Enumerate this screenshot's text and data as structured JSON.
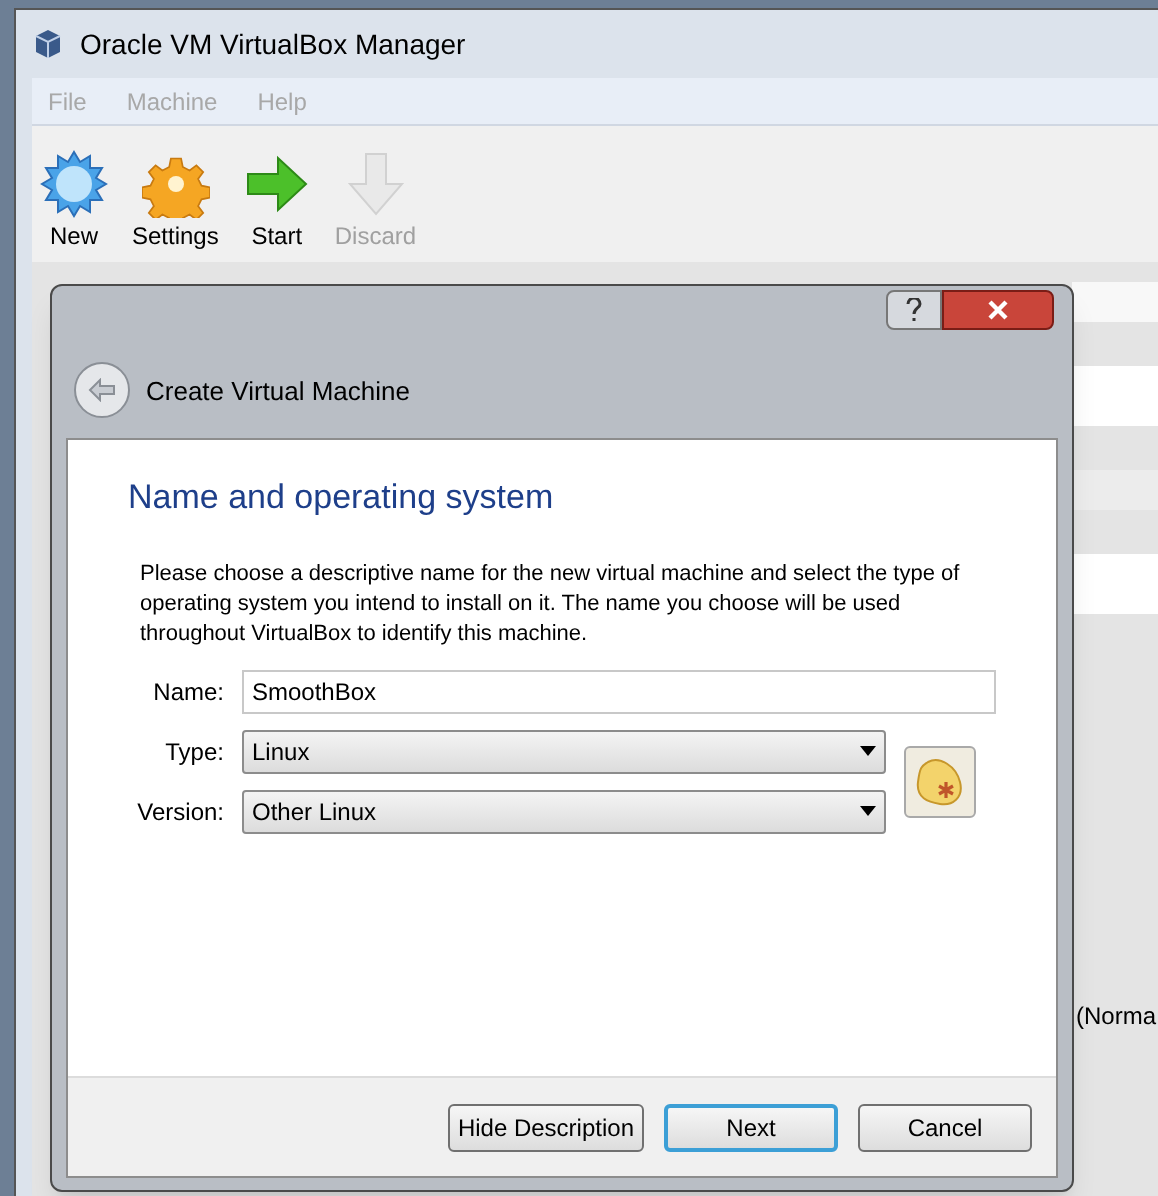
{
  "window": {
    "title": "Oracle VM VirtualBox Manager"
  },
  "menu": [
    {
      "label": "File",
      "disabled": true
    },
    {
      "label": "Machine",
      "disabled": true
    },
    {
      "label": "Help",
      "disabled": true
    }
  ],
  "toolbar": [
    {
      "kind": "new",
      "label": "New",
      "disabled": false
    },
    {
      "kind": "settings",
      "label": "Settings",
      "disabled": false
    },
    {
      "kind": "start",
      "label": "Start",
      "disabled": false
    },
    {
      "kind": "discard",
      "label": "Discard",
      "disabled": true
    }
  ],
  "background_text": "(Norma",
  "dialog": {
    "title": "Create Virtual Machine",
    "heading": "Name and operating system",
    "description": "Please choose a descriptive name for the new virtual machine and select the type of operating system you intend to install on it. The name you choose will be used throughout VirtualBox to identify this machine.",
    "fields": [
      {
        "kind": "text",
        "label": "Name:",
        "value": "SmoothBox"
      },
      {
        "kind": "select",
        "label": "Type:",
        "value": "Linux"
      },
      {
        "kind": "select",
        "label": "Version:",
        "value": "Other Linux"
      }
    ],
    "buttons": [
      {
        "label": "Hide Description",
        "default": false
      },
      {
        "label": "Next",
        "default": true
      },
      {
        "label": "Cancel",
        "default": false
      }
    ]
  }
}
